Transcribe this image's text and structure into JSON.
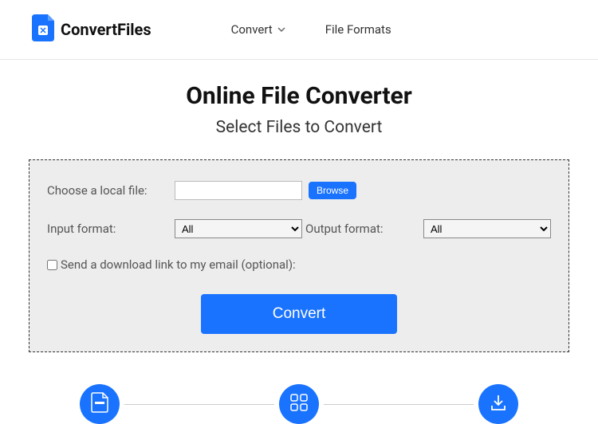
{
  "header": {
    "brand": "ConvertFiles",
    "nav": {
      "convert": "Convert",
      "formats": "File Formats"
    }
  },
  "main": {
    "title": "Online File Converter",
    "subtitle": "Select Files to Convert",
    "choose_label": "Choose a local file:",
    "browse_label": "Browse",
    "input_format_label": "Input format:",
    "input_format_value": "All",
    "output_format_label": "Output format:",
    "output_format_value": "All",
    "checkbox_label": "Send a download link to my email (optional):",
    "convert_label": "Convert"
  },
  "colors": {
    "primary": "#1a73ff"
  }
}
